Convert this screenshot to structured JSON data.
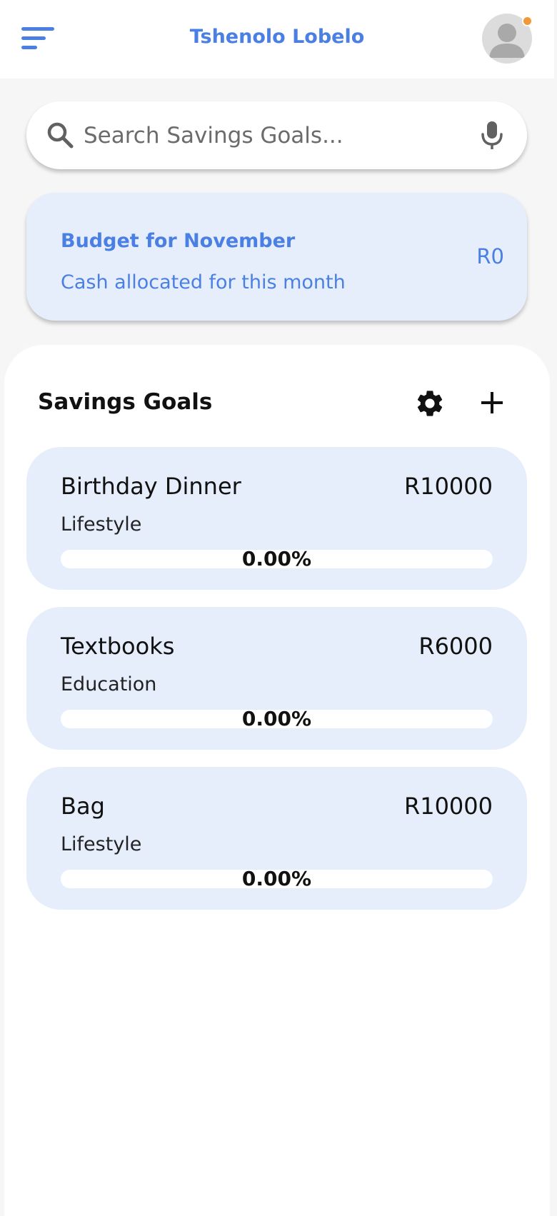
{
  "header": {
    "title": "Tshenolo Lobelo",
    "menu_icon": "menu-icon",
    "avatar_icon": "person-icon",
    "notification_color": "#f49739"
  },
  "search": {
    "placeholder": "Search Savings Goals...",
    "value": "",
    "search_icon": "search-icon",
    "mic_icon": "mic-icon"
  },
  "budget": {
    "title": "Budget for November",
    "subtitle": "Cash allocated for this month",
    "amount": "R0"
  },
  "goals": {
    "heading": "Savings Goals",
    "settings_icon": "gear-icon",
    "add_icon": "plus-icon",
    "items": [
      {
        "name": "Birthday Dinner",
        "amount": "R10000",
        "category": "Lifestyle",
        "progress_label": "0.00%",
        "progress": 0
      },
      {
        "name": "Textbooks",
        "amount": "R6000",
        "category": "Education",
        "progress_label": "0.00%",
        "progress": 0
      },
      {
        "name": "Bag",
        "amount": "R10000",
        "category": "Lifestyle",
        "progress_label": "0.00%",
        "progress": 0
      }
    ]
  },
  "colors": {
    "accent": "#4a7fe3",
    "card_background": "#e6eefc"
  }
}
